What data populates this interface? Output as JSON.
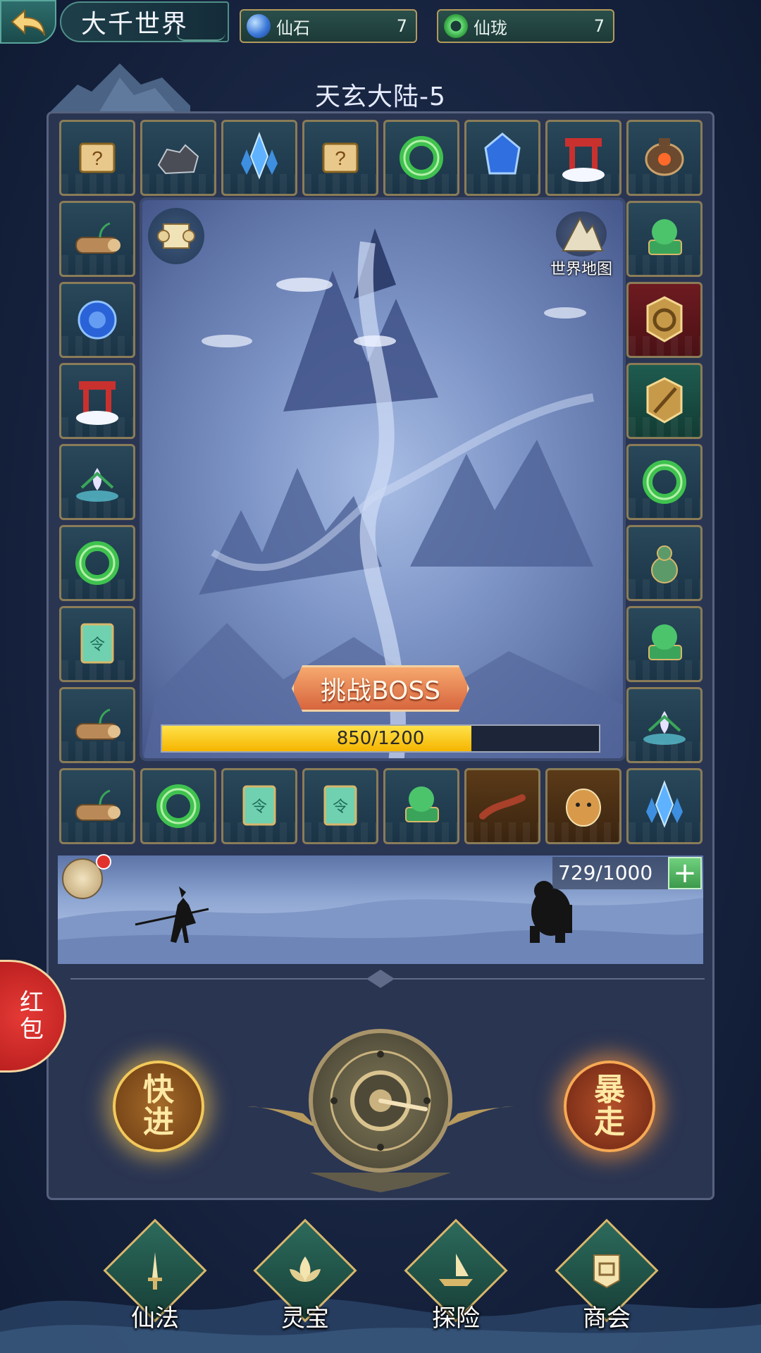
{
  "header": {
    "back_icon": "back-arrow-icon",
    "title": "大千世界",
    "currencies": [
      {
        "name": "仙石",
        "value": "7",
        "icon": "blue-gem-icon",
        "color": "#4a86e0"
      },
      {
        "name": "仙珑",
        "value": "7",
        "icon": "jade-ring-icon",
        "color": "#3fbf4d"
      }
    ]
  },
  "stage": {
    "title": "天玄大陆-5"
  },
  "board": {
    "tiles": [
      {
        "icon": "mystery-scroll-icon",
        "bg": "dark"
      },
      {
        "icon": "iron-ore-icon",
        "bg": "dark"
      },
      {
        "icon": "blue-crystal-icon",
        "bg": "dark"
      },
      {
        "icon": "mystery-scroll-icon",
        "bg": "dark"
      },
      {
        "icon": "jade-ring-icon",
        "bg": "dark"
      },
      {
        "icon": "blue-gem-icon",
        "bg": "dark"
      },
      {
        "icon": "gate-icon",
        "bg": "dark"
      },
      {
        "icon": "cauldron-icon",
        "bg": "dark"
      },
      {
        "icon": "green-beast-statue-icon",
        "bg": "dark"
      },
      {
        "icon": "refresh-token-icon",
        "bg": "red"
      },
      {
        "icon": "spear-token-icon",
        "bg": "teal"
      },
      {
        "icon": "jade-ring-icon",
        "bg": "dark"
      },
      {
        "icon": "gourd-bottle-icon",
        "bg": "dark"
      },
      {
        "icon": "green-beast-statue-icon",
        "bg": "dark"
      },
      {
        "icon": "spirit-lotus-icon",
        "bg": "dark"
      },
      {
        "icon": "blue-crystal-icon",
        "bg": "dark"
      },
      {
        "icon": "tiger-icon",
        "bg": "brown"
      },
      {
        "icon": "centipede-icon",
        "bg": "brown"
      },
      {
        "icon": "green-beast-statue-icon",
        "bg": "dark"
      },
      {
        "icon": "command-token-icon",
        "bg": "dark"
      },
      {
        "icon": "command-token-icon",
        "bg": "dark"
      },
      {
        "icon": "jade-ring-icon",
        "bg": "dark"
      },
      {
        "icon": "sprout-log-icon",
        "bg": "dark"
      },
      {
        "icon": "sprout-log-icon",
        "bg": "dark"
      },
      {
        "icon": "command-token-icon",
        "bg": "dark"
      },
      {
        "icon": "jade-ring-icon",
        "bg": "dark"
      },
      {
        "icon": "spirit-lotus-icon",
        "bg": "dark"
      },
      {
        "icon": "gate-icon",
        "bg": "dark"
      },
      {
        "icon": "blue-orb-icon",
        "bg": "dark"
      },
      {
        "icon": "sprout-log-icon",
        "bg": "dark"
      }
    ],
    "world_map_label": "世界地图",
    "boss_button": "挑战BOSS",
    "progress": {
      "current": 850,
      "max": 1200,
      "text": "850/1200"
    }
  },
  "battle": {
    "stamina_text": "729/1000",
    "plus_label": "+"
  },
  "controls": {
    "red_packet": "红包",
    "fast_forward": "快进",
    "rampage": "暴走"
  },
  "nav": [
    {
      "label": "仙法",
      "icon": "sword-icon"
    },
    {
      "label": "灵宝",
      "icon": "lotus-icon"
    },
    {
      "label": "探险",
      "icon": "boat-icon"
    },
    {
      "label": "商会",
      "icon": "shop-banner-icon"
    }
  ],
  "colors": {
    "progress_fill": "#f5c400",
    "frame_gold": "#8a7c57",
    "accent_green": "#3fbf4d"
  }
}
